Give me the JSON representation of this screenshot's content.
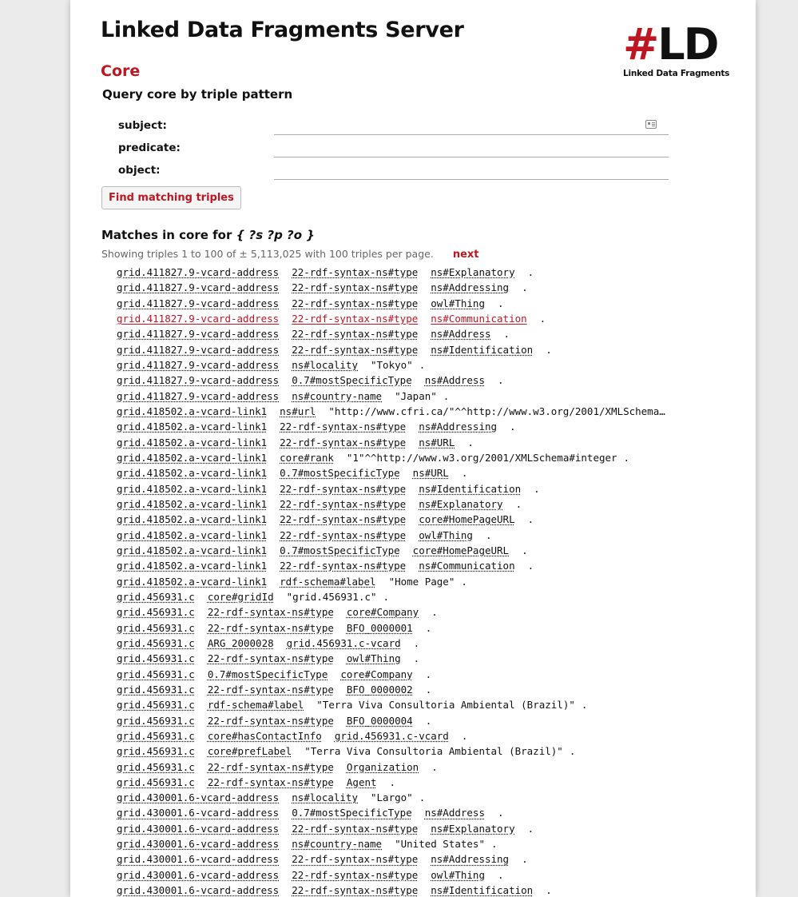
{
  "header": {
    "server_title": "Linked Data Fragments Server",
    "logo_hash": "#",
    "logo_ld": "LD",
    "logo_caption": "Linked Data Fragments"
  },
  "dataset": {
    "title": "Core",
    "query_heading": "Query core by triple pattern"
  },
  "form": {
    "subject_label": "subject:",
    "predicate_label": "predicate:",
    "object_label": "object:",
    "subject_value": "",
    "predicate_value": "",
    "object_value": "",
    "submit_label": "Find matching triples"
  },
  "results": {
    "heading_prefix": "Matches in core for",
    "heading_pattern": "{ ?s ?p ?o }",
    "count_text": "Showing triples 1 to 100 of ± 5,113,025 with 100 triples per page.",
    "next_label": "next"
  },
  "triples": [
    {
      "s": "grid.411827.9-vcard-address",
      "p": "22-rdf-syntax-ns#type",
      "o": "ns#Explanatory",
      "o_literal": false
    },
    {
      "s": "grid.411827.9-vcard-address",
      "p": "22-rdf-syntax-ns#type",
      "o": "ns#Addressing",
      "o_literal": false
    },
    {
      "s": "grid.411827.9-vcard-address",
      "p": "22-rdf-syntax-ns#type",
      "o": "owl#Thing",
      "o_literal": false
    },
    {
      "s": "grid.411827.9-vcard-address",
      "p": "22-rdf-syntax-ns#type",
      "o": "ns#Communication",
      "o_literal": false,
      "highlight": true
    },
    {
      "s": "grid.411827.9-vcard-address",
      "p": "22-rdf-syntax-ns#type",
      "o": "ns#Address",
      "o_literal": false
    },
    {
      "s": "grid.411827.9-vcard-address",
      "p": "22-rdf-syntax-ns#type",
      "o": "ns#Identification",
      "o_literal": false
    },
    {
      "s": "grid.411827.9-vcard-address",
      "p": "ns#locality",
      "o": "\"Tokyo\"",
      "o_literal": true
    },
    {
      "s": "grid.411827.9-vcard-address",
      "p": "0.7#mostSpecificType",
      "o": "ns#Address",
      "o_literal": false
    },
    {
      "s": "grid.411827.9-vcard-address",
      "p": "ns#country-name",
      "o": "\"Japan\"",
      "o_literal": true
    },
    {
      "s": "grid.418502.a-vcard-link1",
      "p": "ns#url",
      "o": "\"http://www.cfri.ca/\"^^http://www.w3.org/2001/XMLSchema…",
      "o_literal": true,
      "no_dot": true
    },
    {
      "s": "grid.418502.a-vcard-link1",
      "p": "22-rdf-syntax-ns#type",
      "o": "ns#Addressing",
      "o_literal": false
    },
    {
      "s": "grid.418502.a-vcard-link1",
      "p": "22-rdf-syntax-ns#type",
      "o": "ns#URL",
      "o_literal": false
    },
    {
      "s": "grid.418502.a-vcard-link1",
      "p": "core#rank",
      "o": "\"1\"^^http://www.w3.org/2001/XMLSchema#integer",
      "o_literal": true
    },
    {
      "s": "grid.418502.a-vcard-link1",
      "p": "0.7#mostSpecificType",
      "o": "ns#URL",
      "o_literal": false
    },
    {
      "s": "grid.418502.a-vcard-link1",
      "p": "22-rdf-syntax-ns#type",
      "o": "ns#Identification",
      "o_literal": false
    },
    {
      "s": "grid.418502.a-vcard-link1",
      "p": "22-rdf-syntax-ns#type",
      "o": "ns#Explanatory",
      "o_literal": false
    },
    {
      "s": "grid.418502.a-vcard-link1",
      "p": "22-rdf-syntax-ns#type",
      "o": "core#HomePageURL",
      "o_literal": false
    },
    {
      "s": "grid.418502.a-vcard-link1",
      "p": "22-rdf-syntax-ns#type",
      "o": "owl#Thing",
      "o_literal": false
    },
    {
      "s": "grid.418502.a-vcard-link1",
      "p": "0.7#mostSpecificType",
      "o": "core#HomePageURL",
      "o_literal": false
    },
    {
      "s": "grid.418502.a-vcard-link1",
      "p": "22-rdf-syntax-ns#type",
      "o": "ns#Communication",
      "o_literal": false
    },
    {
      "s": "grid.418502.a-vcard-link1",
      "p": "rdf-schema#label",
      "o": "\"Home Page\"",
      "o_literal": true
    },
    {
      "s": "grid.456931.c",
      "p": "core#gridId",
      "o": "\"grid.456931.c\"",
      "o_literal": true
    },
    {
      "s": "grid.456931.c",
      "p": "22-rdf-syntax-ns#type",
      "o": "core#Company",
      "o_literal": false
    },
    {
      "s": "grid.456931.c",
      "p": "22-rdf-syntax-ns#type",
      "o": "BFO_0000001",
      "o_literal": false
    },
    {
      "s": "grid.456931.c",
      "p": "ARG_2000028",
      "o": "grid.456931.c-vcard",
      "o_literal": false
    },
    {
      "s": "grid.456931.c",
      "p": "22-rdf-syntax-ns#type",
      "o": "owl#Thing",
      "o_literal": false
    },
    {
      "s": "grid.456931.c",
      "p": "0.7#mostSpecificType",
      "o": "core#Company",
      "o_literal": false
    },
    {
      "s": "grid.456931.c",
      "p": "22-rdf-syntax-ns#type",
      "o": "BFO_0000002",
      "o_literal": false
    },
    {
      "s": "grid.456931.c",
      "p": "rdf-schema#label",
      "o": "\"Terra Viva Consultoria Ambiental (Brazil)\"",
      "o_literal": true
    },
    {
      "s": "grid.456931.c",
      "p": "22-rdf-syntax-ns#type",
      "o": "BFO_0000004",
      "o_literal": false
    },
    {
      "s": "grid.456931.c",
      "p": "core#hasContactInfo",
      "o": "grid.456931.c-vcard",
      "o_literal": false
    },
    {
      "s": "grid.456931.c",
      "p": "core#prefLabel",
      "o": "\"Terra Viva Consultoria Ambiental (Brazil)\"",
      "o_literal": true
    },
    {
      "s": "grid.456931.c",
      "p": "22-rdf-syntax-ns#type",
      "o": "Organization",
      "o_literal": false
    },
    {
      "s": "grid.456931.c",
      "p": "22-rdf-syntax-ns#type",
      "o": "Agent",
      "o_literal": false
    },
    {
      "s": "grid.430001.6-vcard-address",
      "p": "ns#locality",
      "o": "\"Largo\"",
      "o_literal": true
    },
    {
      "s": "grid.430001.6-vcard-address",
      "p": "0.7#mostSpecificType",
      "o": "ns#Address",
      "o_literal": false
    },
    {
      "s": "grid.430001.6-vcard-address",
      "p": "22-rdf-syntax-ns#type",
      "o": "ns#Explanatory",
      "o_literal": false
    },
    {
      "s": "grid.430001.6-vcard-address",
      "p": "ns#country-name",
      "o": "\"United States\"",
      "o_literal": true
    },
    {
      "s": "grid.430001.6-vcard-address",
      "p": "22-rdf-syntax-ns#type",
      "o": "ns#Addressing",
      "o_literal": false
    },
    {
      "s": "grid.430001.6-vcard-address",
      "p": "22-rdf-syntax-ns#type",
      "o": "owl#Thing",
      "o_literal": false
    },
    {
      "s": "grid.430001.6-vcard-address",
      "p": "22-rdf-syntax-ns#type",
      "o": "ns#Identification",
      "o_literal": false
    }
  ],
  "icons": {
    "subject_field_icon": "contact-card-icon"
  },
  "colors": {
    "accent": "#be1622",
    "text": "#111111",
    "muted": "#666666",
    "page_background": "#ebebeb"
  }
}
